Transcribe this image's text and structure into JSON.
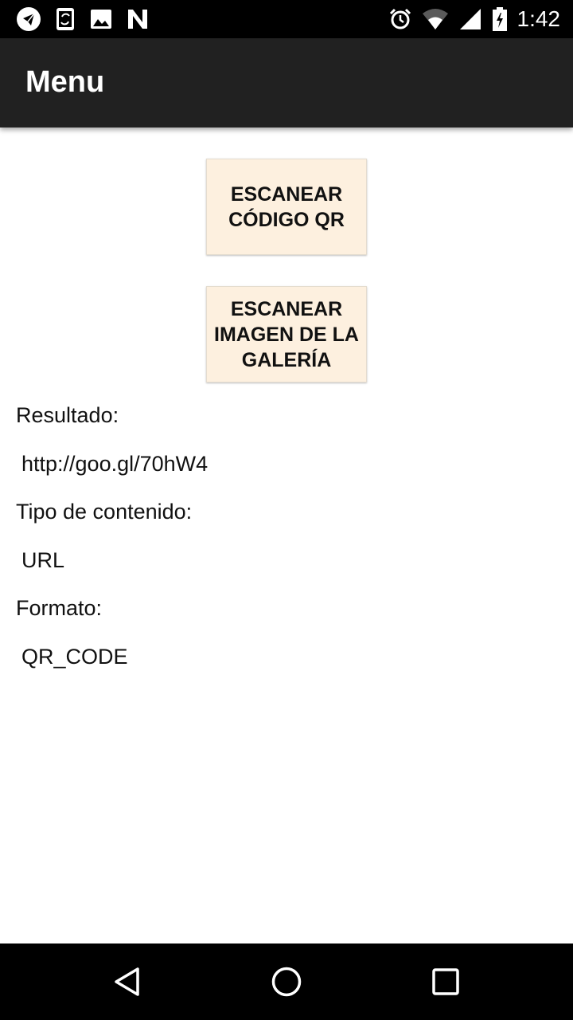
{
  "status_bar": {
    "time": "1:42",
    "left_icons": [
      "telegram-icon",
      "phone-sync-icon",
      "image-icon",
      "n-app-icon"
    ],
    "right_icons": [
      "alarm-icon",
      "wifi-icon",
      "signal-icon",
      "battery-icon"
    ]
  },
  "app_bar": {
    "title": "Menu"
  },
  "buttons": {
    "scan_qr": "ESCANEAR CÓDIGO QR",
    "scan_gallery": "ESCANEAR IMAGEN DE LA GALERÍA"
  },
  "result": {
    "result_label": "Resultado:",
    "result_value": "http://goo.gl/70hW4",
    "content_type_label": "Tipo de contenido:",
    "content_type_value": "URL",
    "format_label": "Formato:",
    "format_value": "QR_CODE"
  },
  "nav_bar": {
    "icons": [
      "back-icon",
      "home-icon",
      "recents-icon"
    ]
  },
  "colors": {
    "app_bar": "#212121",
    "button_bg": "#fdf0df",
    "status_bar": "#000000"
  }
}
